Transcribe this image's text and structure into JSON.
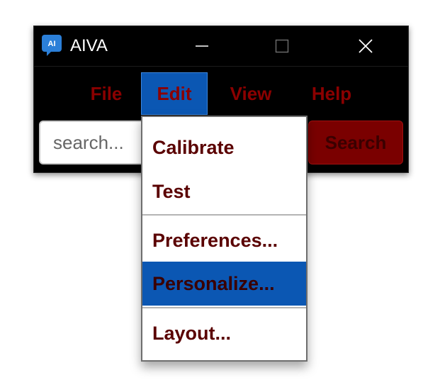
{
  "window": {
    "title": "AIVA",
    "icon": "ai-chat-icon",
    "icon_label": "AI",
    "controls": [
      "minimize-icon",
      "maximize-icon",
      "close-icon"
    ]
  },
  "menubar": {
    "items": [
      {
        "label": "File",
        "active": false
      },
      {
        "label": "Edit",
        "active": true
      },
      {
        "label": "View",
        "active": false
      },
      {
        "label": "Help",
        "active": false
      }
    ]
  },
  "search": {
    "placeholder": "search...",
    "button_label": "Search"
  },
  "edit_menu": {
    "items": [
      {
        "label": "Calibrate",
        "highlighted": false
      },
      {
        "label": "Test",
        "highlighted": false
      },
      {
        "label": "Preferences...",
        "highlighted": false
      },
      {
        "label": "Personalize...",
        "highlighted": true
      },
      {
        "label": "Layout...",
        "highlighted": false
      }
    ]
  },
  "colors": {
    "window_bg": "#000000",
    "menu_text": "#8b0000",
    "highlight": "#0b57b3",
    "button_bg": "#7a0000",
    "dropdown_text": "#5a0000"
  }
}
